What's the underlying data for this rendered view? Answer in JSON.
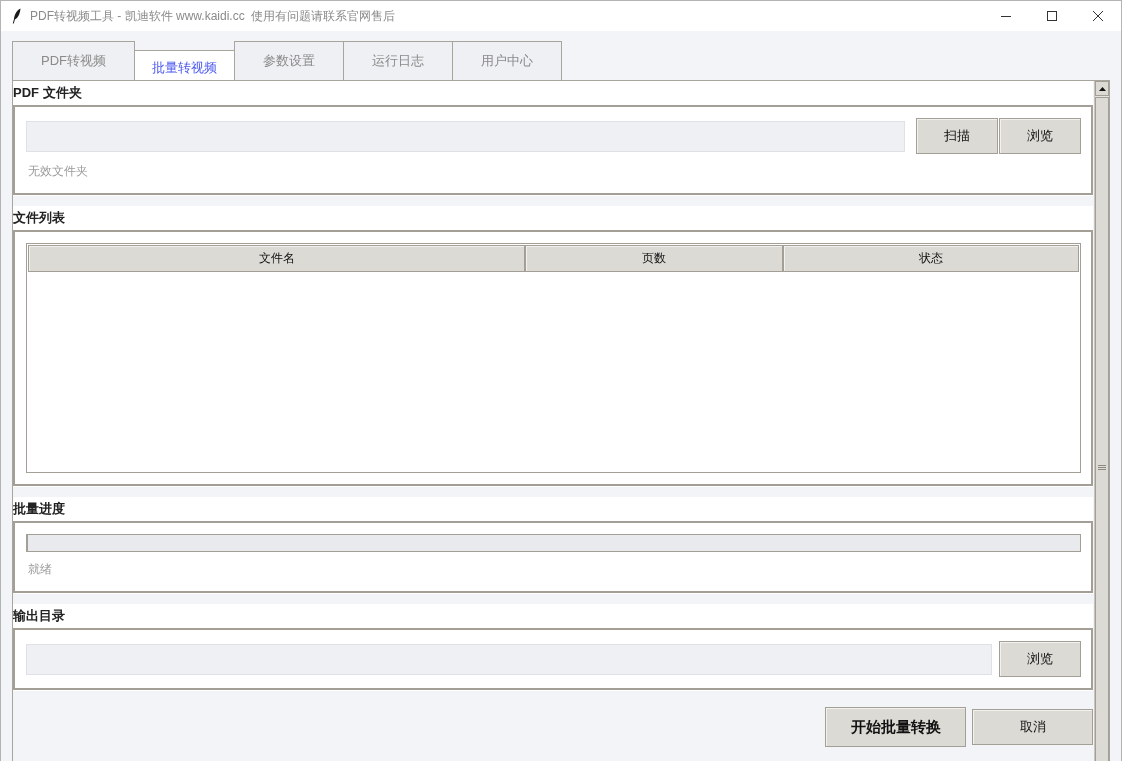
{
  "window": {
    "title": "PDF转视频工具 - 凯迪软件 www.kaidi.cc  使用有问题请联系官网售后"
  },
  "tabs": [
    {
      "label": "PDF转视频",
      "selected": false
    },
    {
      "label": "批量转视频",
      "selected": true
    },
    {
      "label": "参数设置",
      "selected": false
    },
    {
      "label": "运行日志",
      "selected": false
    },
    {
      "label": "用户中心",
      "selected": false
    }
  ],
  "sections": [
    {
      "kind": "folder_picker",
      "title": "PDF 文件夹",
      "buttons": [
        "扫描",
        "浏览"
      ],
      "status": "无效文件夹"
    },
    {
      "kind": "table",
      "title": "文件列表",
      "columns": [
        "文件名",
        "页数",
        "状态"
      ]
    },
    {
      "kind": "progress",
      "title": "批量进度",
      "level": 0,
      "status": "就绪"
    },
    {
      "kind": "folder_picker",
      "title": "输出目录",
      "buttons": [
        "浏览"
      ]
    }
  ],
  "actions": [
    {
      "label": "开始批量转换",
      "kind": "primary"
    },
    {
      "label": "取消",
      "kind": "secondary"
    }
  ]
}
